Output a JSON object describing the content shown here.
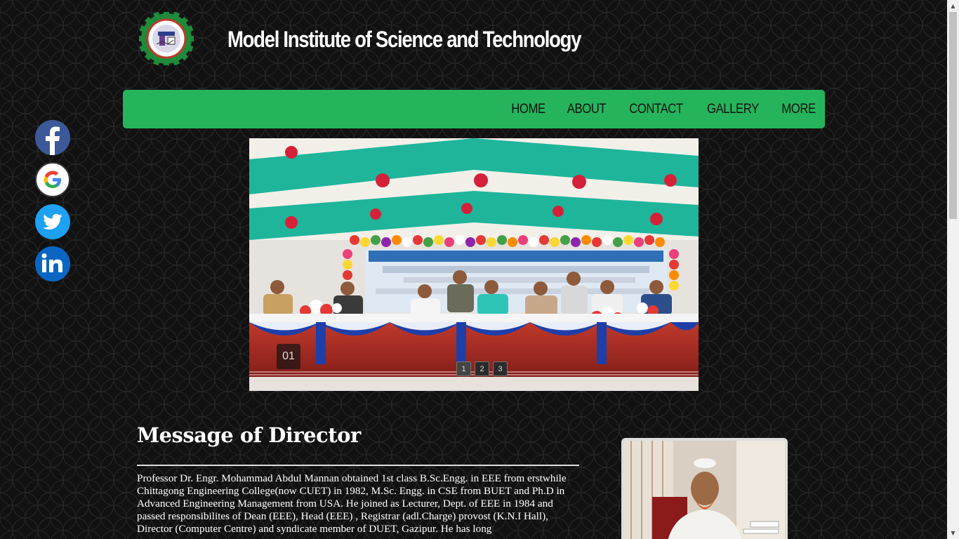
{
  "header": {
    "site_title": "Model Institute of Science and Technology"
  },
  "nav": {
    "items": [
      "HOME",
      "ABOUT",
      "CONTACT",
      "GALLERY",
      "MORE"
    ]
  },
  "social": {
    "items": [
      {
        "name": "facebook",
        "icon": "facebook-icon",
        "color": "#3b5998"
      },
      {
        "name": "google",
        "icon": "google-icon",
        "color": "#ffffff"
      },
      {
        "name": "twitter",
        "icon": "twitter-icon",
        "color": "#1da1f2"
      },
      {
        "name": "linkedin",
        "icon": "linkedin-icon",
        "color": "#0a66c2"
      }
    ]
  },
  "slider": {
    "current": "01",
    "dots": [
      "1",
      "2",
      "3"
    ],
    "active_dot": 1
  },
  "director": {
    "title": "Message of Director",
    "body": "Professor Dr. Engr. Mohammad Abdul Mannan obtained 1st class B.Sc.Engg. in EEE from erstwhile Chittagong Engineering College(now CUET) in 1982, M.Sc. Engg. in CSE from BUET and Ph.D in Advanced Engineering Management from USA. He joined as Lecturer, Dept. of EEE in 1984 and passed responsibilites of Dean (EEE), Head (EEE) , Registrar (adl.Charge) provost (K.N.I Hall), Director (Computer Centre) and syndicate member of DUET, Gazipur. He has long"
  },
  "colors": {
    "nav_bg": "#25b45c",
    "page_bg": "#111111"
  }
}
